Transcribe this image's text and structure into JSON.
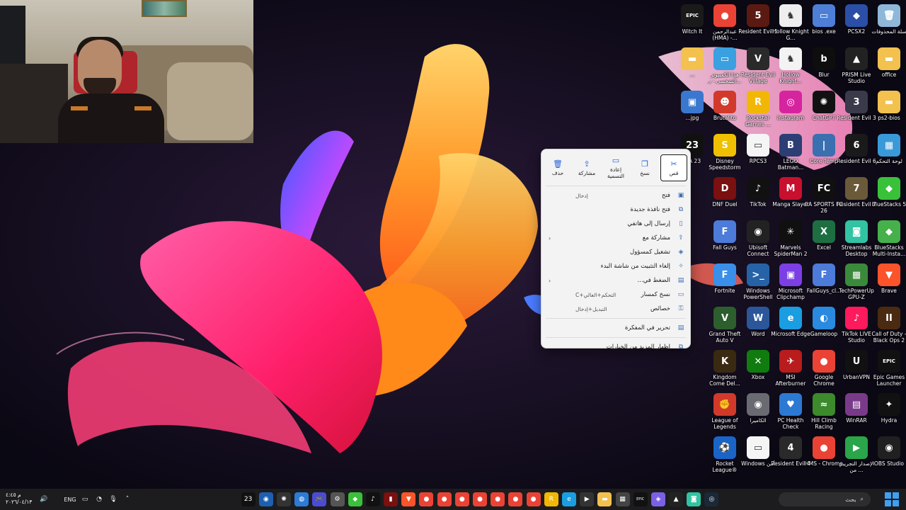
{
  "desktop_icons": [
    {
      "label": "Witch It",
      "icon": "witch-it-icon",
      "color": "#1a1a1a",
      "glyph": "EPIC"
    },
    {
      "label": "عبدالرحمن (HMA) -...",
      "icon": "chrome-icon",
      "color": "#ea4335",
      "glyph": "●"
    },
    {
      "label": "Resident Evil 5",
      "icon": "resident-evil-5-icon",
      "color": "#5a1a12",
      "glyph": "5"
    },
    {
      "label": "Hollow Knight G...",
      "icon": "hollow-knight-icon",
      "color": "#eeeeee",
      "glyph": "♞"
    },
    {
      "label": "bios .exe",
      "icon": "file-icon",
      "color": "#4d7fd6",
      "glyph": "▭"
    },
    {
      "label": "PCSX2",
      "icon": "pcsx2-icon",
      "color": "#2b4fa6",
      "glyph": "◆"
    },
    {
      "label": "سلة المحذوفات",
      "icon": "recycle-bin-icon",
      "color": "#8fb8d8",
      "glyph": "🗑"
    },
    {
      "label": "هذا الكمبيوتر الشخصي - ر...",
      "icon": "this-pc-icon",
      "color": "#3aa0e0",
      "glyph": "▭"
    },
    {
      "label": "Resident Evil Village",
      "icon": "resident-evil-village-icon",
      "color": "#2a2a2a",
      "glyph": "V"
    },
    {
      "label": "Hollow Knight...",
      "icon": "hollow-knight-2-icon",
      "color": "#f3f3f3",
      "glyph": "♞"
    },
    {
      "label": "Blur",
      "icon": "blur-icon",
      "color": "#0e0e0e",
      "glyph": "b"
    },
    {
      "label": "PRISM Live Studio",
      "icon": "prism-icon",
      "color": "#222222",
      "glyph": "▲"
    },
    {
      "label": "office",
      "icon": "folder-icon",
      "color": "#f2c14e",
      "glyph": "▬"
    },
    {
      "label": "Brutalito",
      "icon": "brutalito-icon",
      "color": "#d13a2a",
      "glyph": "☻"
    },
    {
      "label": "Rockstar Games ...",
      "icon": "rockstar-icon",
      "color": "#f2b705",
      "glyph": "R"
    },
    {
      "label": "Instagram",
      "icon": "instagram-icon",
      "color": "#d6249f",
      "glyph": "◎"
    },
    {
      "label": "ChatGPT",
      "icon": "chatgpt-icon",
      "color": "#111111",
      "glyph": "✺"
    },
    {
      "label": "Resident Evil 3",
      "icon": "resident-evil-3-icon",
      "color": "#3a3a4a",
      "glyph": "3"
    },
    {
      "label": "ps2-bios",
      "icon": "folder-icon",
      "color": "#f2c14e",
      "glyph": "▬"
    },
    {
      "label": "Disney Speedstorm",
      "icon": "speedstorm-icon",
      "color": "#f0c000",
      "glyph": "S"
    },
    {
      "label": "RPCS3",
      "icon": "rpcs3-icon",
      "color": "#f5f5f5",
      "glyph": "▭"
    },
    {
      "label": "LEGO Batman...",
      "icon": "lego-batman-icon",
      "color": "#2c3e74",
      "glyph": "B"
    },
    {
      "label": "Core Temp",
      "icon": "core-temp-icon",
      "color": "#3a6fb0",
      "glyph": "|"
    },
    {
      "label": "Resident Evil 6",
      "icon": "resident-evil-6-icon",
      "color": "#1a1a1a",
      "glyph": "6"
    },
    {
      "label": "لوحة التحكم",
      "icon": "control-panel-icon",
      "color": "#3a9ad9",
      "glyph": "▦"
    },
    {
      "label": "DNF Duel",
      "icon": "dnf-duel-icon",
      "color": "#7a1010",
      "glyph": "D"
    },
    {
      "label": "TikTok",
      "icon": "tiktok-icon",
      "color": "#111111",
      "glyph": "♪"
    },
    {
      "label": "Manga Slayer",
      "icon": "manga-slayer-icon",
      "color": "#c8102e",
      "glyph": "M"
    },
    {
      "label": "EA SPORTS FC 26",
      "icon": "ea-fc-icon",
      "color": "#101010",
      "glyph": "FC"
    },
    {
      "label": "Resident Evil 7",
      "icon": "resident-evil-7-icon",
      "color": "#6a5a3a",
      "glyph": "7"
    },
    {
      "label": "BlueStacks 5",
      "icon": "bluestacks-icon",
      "color": "#3ac13a",
      "glyph": "◆"
    },
    {
      "label": "Fall Guys",
      "icon": "fall-guys-icon",
      "color": "#4c7bd9",
      "glyph": "F"
    },
    {
      "label": "Ubisoft Connect",
      "icon": "ubisoft-icon",
      "color": "#222222",
      "glyph": "◉"
    },
    {
      "label": "Marvels SpiderMan 2",
      "icon": "spiderman-icon",
      "color": "#101010",
      "glyph": "✳"
    },
    {
      "label": "Excel",
      "icon": "excel-icon",
      "color": "#1d6f42",
      "glyph": "X"
    },
    {
      "label": "Streamlabs Desktop",
      "icon": "streamlabs-icon",
      "color": "#31c3a2",
      "glyph": "◙"
    },
    {
      "label": "BlueStacks Multi-Insta...",
      "icon": "bluestacks-multi-icon",
      "color": "#46b04a",
      "glyph": "◆"
    },
    {
      "label": "Fortnite",
      "icon": "fortnite-icon",
      "color": "#3a8fe8",
      "glyph": "F"
    },
    {
      "label": "Windows PowerShell",
      "icon": "powershell-icon",
      "color": "#2563a6",
      "glyph": ">_"
    },
    {
      "label": "Microsoft Clipchamp",
      "icon": "clipchamp-icon",
      "color": "#7b3fe4",
      "glyph": "▣"
    },
    {
      "label": "FallGuys_cl...",
      "icon": "fallguys-client-icon",
      "color": "#4c7bd9",
      "glyph": "F"
    },
    {
      "label": "TechPowerUp GPU-Z",
      "icon": "gpu-z-icon",
      "color": "#3b8a3b",
      "glyph": "▦"
    },
    {
      "label": "Brave",
      "icon": "brave-icon",
      "color": "#fb542b",
      "glyph": "▼"
    },
    {
      "label": "Grand Theft Auto V",
      "icon": "gta-v-icon",
      "color": "#2d5e2d",
      "glyph": "V"
    },
    {
      "label": "Word",
      "icon": "word-icon",
      "color": "#2b579a",
      "glyph": "W"
    },
    {
      "label": "Microsoft Edge",
      "icon": "edge-icon",
      "color": "#1b9de2",
      "glyph": "e"
    },
    {
      "label": "Gameloop",
      "icon": "gameloop-icon",
      "color": "#2a8ae0",
      "glyph": "◐"
    },
    {
      "label": "TikTok LIVE Studio",
      "icon": "tiktok-live-icon",
      "color": "#ff1a5e",
      "glyph": "♪"
    },
    {
      "label": "Call of Duty - Black Ops 2",
      "icon": "cod-icon",
      "color": "#4a2a10",
      "glyph": "II"
    },
    {
      "label": "Kingdom Come Del...",
      "icon": "kingdom-come-icon",
      "color": "#3a2a12",
      "glyph": "K"
    },
    {
      "label": "Xbox",
      "icon": "xbox-icon",
      "color": "#107c10",
      "glyph": "✕"
    },
    {
      "label": "MSI Afterburner",
      "icon": "msi-icon",
      "color": "#b81c1c",
      "glyph": "✈"
    },
    {
      "label": "Google Chrome",
      "icon": "chrome-icon",
      "color": "#ea4335",
      "glyph": "●"
    },
    {
      "label": "UrbanVPN",
      "icon": "urbanvpn-icon",
      "color": "#111111",
      "glyph": "U"
    },
    {
      "label": "Epic Games Launcher",
      "icon": "epic-icon",
      "color": "#111111",
      "glyph": "EPIC"
    },
    {
      "label": "League of Legends",
      "icon": "lol-icon",
      "color": "#d13a2a",
      "glyph": "✊"
    },
    {
      "label": "الكاميرا",
      "icon": "camera-icon",
      "color": "#6a6a72",
      "glyph": "◉"
    },
    {
      "label": "PC Health Check",
      "icon": "health-check-icon",
      "color": "#2c79d4",
      "glyph": "♥"
    },
    {
      "label": "Hill Climb Racing",
      "icon": "hill-climb-icon",
      "color": "#3c8a2c",
      "glyph": "≈"
    },
    {
      "label": "WinRAR",
      "icon": "winrar-icon",
      "color": "#7a3a8a",
      "glyph": "▤"
    },
    {
      "label": "Hydra",
      "icon": "hydra-icon",
      "color": "#111111",
      "glyph": "✦"
    },
    {
      "label": "Rocket League®",
      "icon": "rocket-league-icon",
      "color": "#1a64c8",
      "glyph": "⚽"
    },
    {
      "label": "Windows أمن",
      "icon": "windows-security-icon",
      "color": "#f5f5f5",
      "glyph": "▭"
    },
    {
      "label": "Resident Evil 4",
      "icon": "resident-evil-4-icon",
      "color": "#2a2a2a",
      "glyph": "4"
    },
    {
      "label": "HMS - Chrome",
      "icon": "hms-chrome-icon",
      "color": "#ea4335",
      "glyph": "●"
    },
    {
      "label": "الإصدار التجريبي من ...",
      "icon": "preview-icon",
      "color": "#2aa54a",
      "glyph": "▶"
    },
    {
      "label": "OBS Studio",
      "icon": "obs-icon",
      "color": "#202020",
      "glyph": "◉"
    }
  ],
  "partial_icons": [
    {
      "label": "...",
      "icon": "folder-icon",
      "color": "#f2c14e",
      "glyph": "▬"
    },
    {
      "label": "...jpg",
      "icon": "image-file-icon",
      "color": "#3a78d0",
      "glyph": "▣"
    },
    {
      "label": "...A 23",
      "icon": "fifa-23-icon",
      "color": "#111111",
      "glyph": "23"
    }
  ],
  "context_menu": {
    "toolbar": [
      {
        "label": "قص",
        "icon": "cut-icon",
        "glyph": "✂",
        "active": true
      },
      {
        "label": "نسخ",
        "icon": "copy-icon",
        "glyph": "❐",
        "active": false
      },
      {
        "label": "إعادة التسمية",
        "icon": "rename-icon",
        "glyph": "▭",
        "active": false
      },
      {
        "label": "مشاركة",
        "icon": "share-icon",
        "glyph": "⇪",
        "active": false
      },
      {
        "label": "حذف",
        "icon": "delete-icon",
        "glyph": "🗑",
        "active": false
      }
    ],
    "items": [
      {
        "label": "فتح",
        "shortcut": "إدخال",
        "icon": "open-icon",
        "glyph": "▣",
        "submenu": false
      },
      {
        "label": "فتح نافذة جديدة",
        "shortcut": "",
        "icon": "open-new-window-icon",
        "glyph": "⧉",
        "submenu": false
      },
      {
        "label": "إرسال إلى هاتفي",
        "shortcut": "",
        "icon": "phone-icon",
        "glyph": "▯",
        "submenu": false
      },
      {
        "label": "مشاركة مع",
        "shortcut": "",
        "icon": "share-with-icon",
        "glyph": "⇪",
        "submenu": true
      },
      {
        "label": "تشغيل كمسؤول",
        "shortcut": "",
        "icon": "admin-shield-icon",
        "glyph": "◈",
        "submenu": false
      },
      {
        "label": "إلغاء التثبيت من شاشة البدء",
        "shortcut": "",
        "icon": "unpin-icon",
        "glyph": "✧",
        "submenu": false
      },
      {
        "label": "الضغط في...",
        "shortcut": "",
        "icon": "compress-icon",
        "glyph": "▤",
        "submenu": true
      },
      {
        "label": "نسخ كمسار",
        "shortcut": "التحكم+العالي+C",
        "icon": "copy-path-icon",
        "glyph": "▭",
        "submenu": false
      },
      {
        "label": "خصائص",
        "shortcut": "التبديل+إدخال",
        "icon": "properties-icon",
        "glyph": "⚿",
        "submenu": false
      }
    ],
    "items_after_sep": [
      {
        "label": "تحرير في المفكرة",
        "shortcut": "",
        "icon": "notepad-icon",
        "glyph": "▤",
        "submenu": false
      }
    ],
    "more_options": {
      "label": "إظهار المزيد من الخيارات",
      "icon": "more-options-icon",
      "glyph": "⧉"
    }
  },
  "taskbar": {
    "clock_time": "م ٤:٤٥",
    "clock_date": "٢٠٢٦/٠٤/١٣",
    "language": "ENG",
    "search_placeholder": "بحث",
    "tray": [
      {
        "name": "volume-icon",
        "glyph": "🔊"
      },
      {
        "name": "network-icon",
        "glyph": "▭"
      },
      {
        "name": "defender-icon",
        "glyph": "◔"
      },
      {
        "name": "mic-icon",
        "glyph": "🎙"
      },
      {
        "name": "chevron-up-icon",
        "glyph": "˄"
      }
    ],
    "apps": [
      {
        "name": "fifa-23-app-icon",
        "glyph": "23",
        "color": "#111"
      },
      {
        "name": "gaming-app-icon",
        "glyph": "◉",
        "color": "#1d5fb0"
      },
      {
        "name": "settings-cog-icon",
        "glyph": "✺",
        "color": "#333"
      },
      {
        "name": "globe-app-icon",
        "glyph": "◍",
        "color": "#2d7bd6"
      },
      {
        "name": "controller-app-icon",
        "glyph": "🎮",
        "color": "#4b4bd6"
      },
      {
        "name": "gear-icon",
        "glyph": "⚙",
        "color": "#555"
      },
      {
        "name": "bluestacks-task-icon",
        "glyph": "◆",
        "color": "#3ac13a"
      },
      {
        "name": "tiktok-task-icon",
        "glyph": "♪",
        "color": "#111"
      },
      {
        "name": "red-app-icon",
        "glyph": "▮",
        "color": "#7a1010"
      },
      {
        "name": "brave-task-icon",
        "glyph": "▼",
        "color": "#fb542b"
      },
      {
        "name": "chrome-task-icon-1",
        "glyph": "●",
        "color": "#ea4335"
      },
      {
        "name": "chrome-task-icon-2",
        "glyph": "●",
        "color": "#ea4335"
      },
      {
        "name": "chrome-task-icon-3",
        "glyph": "●",
        "color": "#ea4335"
      },
      {
        "name": "chrome-task-icon-4",
        "glyph": "●",
        "color": "#ea4335"
      },
      {
        "name": "chrome-task-icon-5",
        "glyph": "●",
        "color": "#ea4335"
      },
      {
        "name": "chrome-task-icon-6",
        "glyph": "●",
        "color": "#ea4335"
      },
      {
        "name": "chrome-task-icon-7",
        "glyph": "●",
        "color": "#ea4335"
      },
      {
        "name": "rockstar-task-icon",
        "glyph": "R",
        "color": "#f2b705"
      },
      {
        "name": "edge-task-icon",
        "glyph": "e",
        "color": "#1b9de2"
      },
      {
        "name": "media-player-icon",
        "glyph": "▶",
        "color": "#333"
      },
      {
        "name": "file-explorer-icon",
        "glyph": "▬",
        "color": "#f2c14e"
      },
      {
        "name": "store-icon",
        "glyph": "▦",
        "color": "#444"
      },
      {
        "name": "epic-task-icon",
        "glyph": "EPIC",
        "color": "#111"
      },
      {
        "name": "copilot-icon",
        "glyph": "◈",
        "color": "#7b5fe4"
      },
      {
        "name": "terminal-icon",
        "glyph": "▲",
        "color": "#222"
      },
      {
        "name": "streamlabs-task-icon",
        "glyph": "◙",
        "color": "#31c3a2"
      },
      {
        "name": "steam-icon",
        "glyph": "◎",
        "color": "#1b2838"
      }
    ]
  },
  "colors": {
    "desktop_bg": "#0a0813",
    "taskbar_bg": "#1c1c1e",
    "menu_bg": "#f3f3f3",
    "accent": "#3fa0f0"
  }
}
